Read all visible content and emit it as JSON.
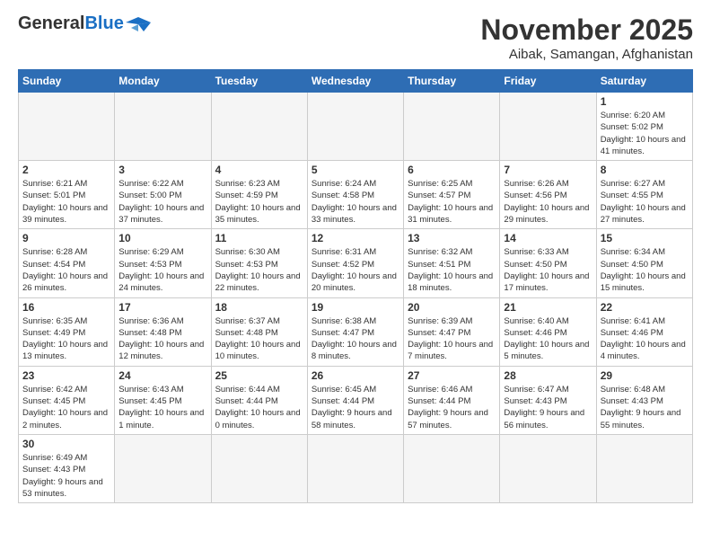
{
  "header": {
    "logo_general": "General",
    "logo_blue": "Blue",
    "month_title": "November 2025",
    "location": "Aibak, Samangan, Afghanistan"
  },
  "days_of_week": [
    "Sunday",
    "Monday",
    "Tuesday",
    "Wednesday",
    "Thursday",
    "Friday",
    "Saturday"
  ],
  "weeks": [
    [
      {
        "day": "",
        "info": ""
      },
      {
        "day": "",
        "info": ""
      },
      {
        "day": "",
        "info": ""
      },
      {
        "day": "",
        "info": ""
      },
      {
        "day": "",
        "info": ""
      },
      {
        "day": "",
        "info": ""
      },
      {
        "day": "1",
        "info": "Sunrise: 6:20 AM\nSunset: 5:02 PM\nDaylight: 10 hours and 41 minutes."
      }
    ],
    [
      {
        "day": "2",
        "info": "Sunrise: 6:21 AM\nSunset: 5:01 PM\nDaylight: 10 hours and 39 minutes."
      },
      {
        "day": "3",
        "info": "Sunrise: 6:22 AM\nSunset: 5:00 PM\nDaylight: 10 hours and 37 minutes."
      },
      {
        "day": "4",
        "info": "Sunrise: 6:23 AM\nSunset: 4:59 PM\nDaylight: 10 hours and 35 minutes."
      },
      {
        "day": "5",
        "info": "Sunrise: 6:24 AM\nSunset: 4:58 PM\nDaylight: 10 hours and 33 minutes."
      },
      {
        "day": "6",
        "info": "Sunrise: 6:25 AM\nSunset: 4:57 PM\nDaylight: 10 hours and 31 minutes."
      },
      {
        "day": "7",
        "info": "Sunrise: 6:26 AM\nSunset: 4:56 PM\nDaylight: 10 hours and 29 minutes."
      },
      {
        "day": "8",
        "info": "Sunrise: 6:27 AM\nSunset: 4:55 PM\nDaylight: 10 hours and 27 minutes."
      }
    ],
    [
      {
        "day": "9",
        "info": "Sunrise: 6:28 AM\nSunset: 4:54 PM\nDaylight: 10 hours and 26 minutes."
      },
      {
        "day": "10",
        "info": "Sunrise: 6:29 AM\nSunset: 4:53 PM\nDaylight: 10 hours and 24 minutes."
      },
      {
        "day": "11",
        "info": "Sunrise: 6:30 AM\nSunset: 4:53 PM\nDaylight: 10 hours and 22 minutes."
      },
      {
        "day": "12",
        "info": "Sunrise: 6:31 AM\nSunset: 4:52 PM\nDaylight: 10 hours and 20 minutes."
      },
      {
        "day": "13",
        "info": "Sunrise: 6:32 AM\nSunset: 4:51 PM\nDaylight: 10 hours and 18 minutes."
      },
      {
        "day": "14",
        "info": "Sunrise: 6:33 AM\nSunset: 4:50 PM\nDaylight: 10 hours and 17 minutes."
      },
      {
        "day": "15",
        "info": "Sunrise: 6:34 AM\nSunset: 4:50 PM\nDaylight: 10 hours and 15 minutes."
      }
    ],
    [
      {
        "day": "16",
        "info": "Sunrise: 6:35 AM\nSunset: 4:49 PM\nDaylight: 10 hours and 13 minutes."
      },
      {
        "day": "17",
        "info": "Sunrise: 6:36 AM\nSunset: 4:48 PM\nDaylight: 10 hours and 12 minutes."
      },
      {
        "day": "18",
        "info": "Sunrise: 6:37 AM\nSunset: 4:48 PM\nDaylight: 10 hours and 10 minutes."
      },
      {
        "day": "19",
        "info": "Sunrise: 6:38 AM\nSunset: 4:47 PM\nDaylight: 10 hours and 8 minutes."
      },
      {
        "day": "20",
        "info": "Sunrise: 6:39 AM\nSunset: 4:47 PM\nDaylight: 10 hours and 7 minutes."
      },
      {
        "day": "21",
        "info": "Sunrise: 6:40 AM\nSunset: 4:46 PM\nDaylight: 10 hours and 5 minutes."
      },
      {
        "day": "22",
        "info": "Sunrise: 6:41 AM\nSunset: 4:46 PM\nDaylight: 10 hours and 4 minutes."
      }
    ],
    [
      {
        "day": "23",
        "info": "Sunrise: 6:42 AM\nSunset: 4:45 PM\nDaylight: 10 hours and 2 minutes."
      },
      {
        "day": "24",
        "info": "Sunrise: 6:43 AM\nSunset: 4:45 PM\nDaylight: 10 hours and 1 minute."
      },
      {
        "day": "25",
        "info": "Sunrise: 6:44 AM\nSunset: 4:44 PM\nDaylight: 10 hours and 0 minutes."
      },
      {
        "day": "26",
        "info": "Sunrise: 6:45 AM\nSunset: 4:44 PM\nDaylight: 9 hours and 58 minutes."
      },
      {
        "day": "27",
        "info": "Sunrise: 6:46 AM\nSunset: 4:44 PM\nDaylight: 9 hours and 57 minutes."
      },
      {
        "day": "28",
        "info": "Sunrise: 6:47 AM\nSunset: 4:43 PM\nDaylight: 9 hours and 56 minutes."
      },
      {
        "day": "29",
        "info": "Sunrise: 6:48 AM\nSunset: 4:43 PM\nDaylight: 9 hours and 55 minutes."
      }
    ],
    [
      {
        "day": "30",
        "info": "Sunrise: 6:49 AM\nSunset: 4:43 PM\nDaylight: 9 hours and 53 minutes."
      },
      {
        "day": "",
        "info": ""
      },
      {
        "day": "",
        "info": ""
      },
      {
        "day": "",
        "info": ""
      },
      {
        "day": "",
        "info": ""
      },
      {
        "day": "",
        "info": ""
      },
      {
        "day": "",
        "info": ""
      }
    ]
  ]
}
